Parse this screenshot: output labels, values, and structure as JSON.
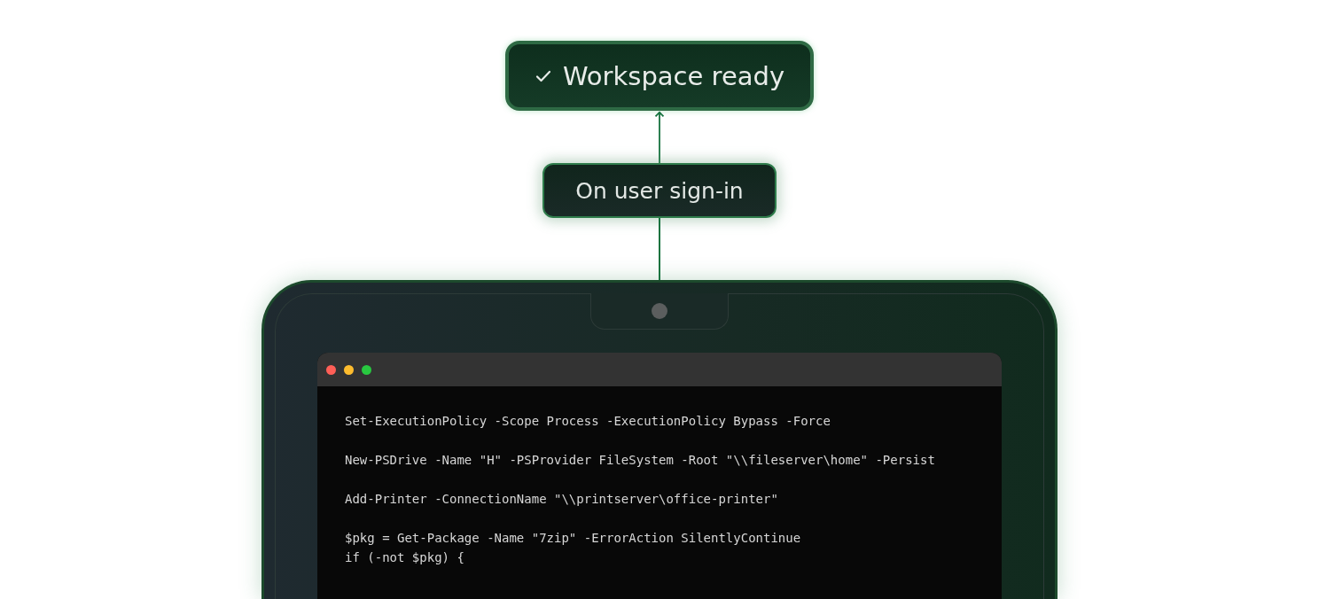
{
  "status_badge": {
    "text": "Workspace ready"
  },
  "trigger_badge": {
    "text": "On user sign-in"
  },
  "terminal": {
    "window_controls": [
      {
        "color": "#ff5f57"
      },
      {
        "color": "#febc2e"
      },
      {
        "color": "#28c840"
      }
    ],
    "code_blocks": [
      [
        "Set-ExecutionPolicy -Scope Process -ExecutionPolicy Bypass -Force"
      ],
      [
        "New-PSDrive -Name \"H\" -PSProvider FileSystem -Root \"\\\\fileserver\\home\" -Persist"
      ],
      [
        "Add-Printer -ConnectionName \"\\\\printserver\\office-printer\""
      ],
      [
        "$pkg = Get-Package -Name \"7zip\" -ErrorAction SilentlyContinue",
        "if (-not $pkg) {"
      ]
    ]
  }
}
